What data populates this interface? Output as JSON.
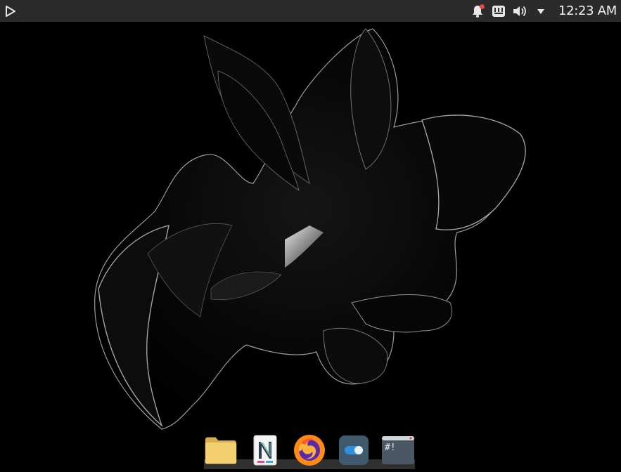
{
  "topbar": {
    "launcher_icon": "play-triangle-icon",
    "tray": {
      "notifications_icon": "bell-icon",
      "notifications_badge_color": "#e8473d",
      "keyboard_icon": "keyboard-indicator-icon",
      "volume_icon": "speaker-icon",
      "menu_icon": "caret-down-icon"
    },
    "clock": "12:23 AM"
  },
  "wallpaper": {
    "description_icon": "abstract-black-glass-flower",
    "background_color": "#000000"
  },
  "dock": {
    "items": [
      {
        "icon": "folder-icon",
        "color": "#f3cf6e"
      },
      {
        "icon": "notes-app-icon",
        "color": "#f4f4f4"
      },
      {
        "icon": "firefox-icon",
        "color": "#ff8a15"
      },
      {
        "icon": "toggle-settings-icon",
        "color": "#3f5a6c"
      },
      {
        "icon": "terminal-icon",
        "color": "#4a5866",
        "glyph": "#!"
      }
    ]
  }
}
